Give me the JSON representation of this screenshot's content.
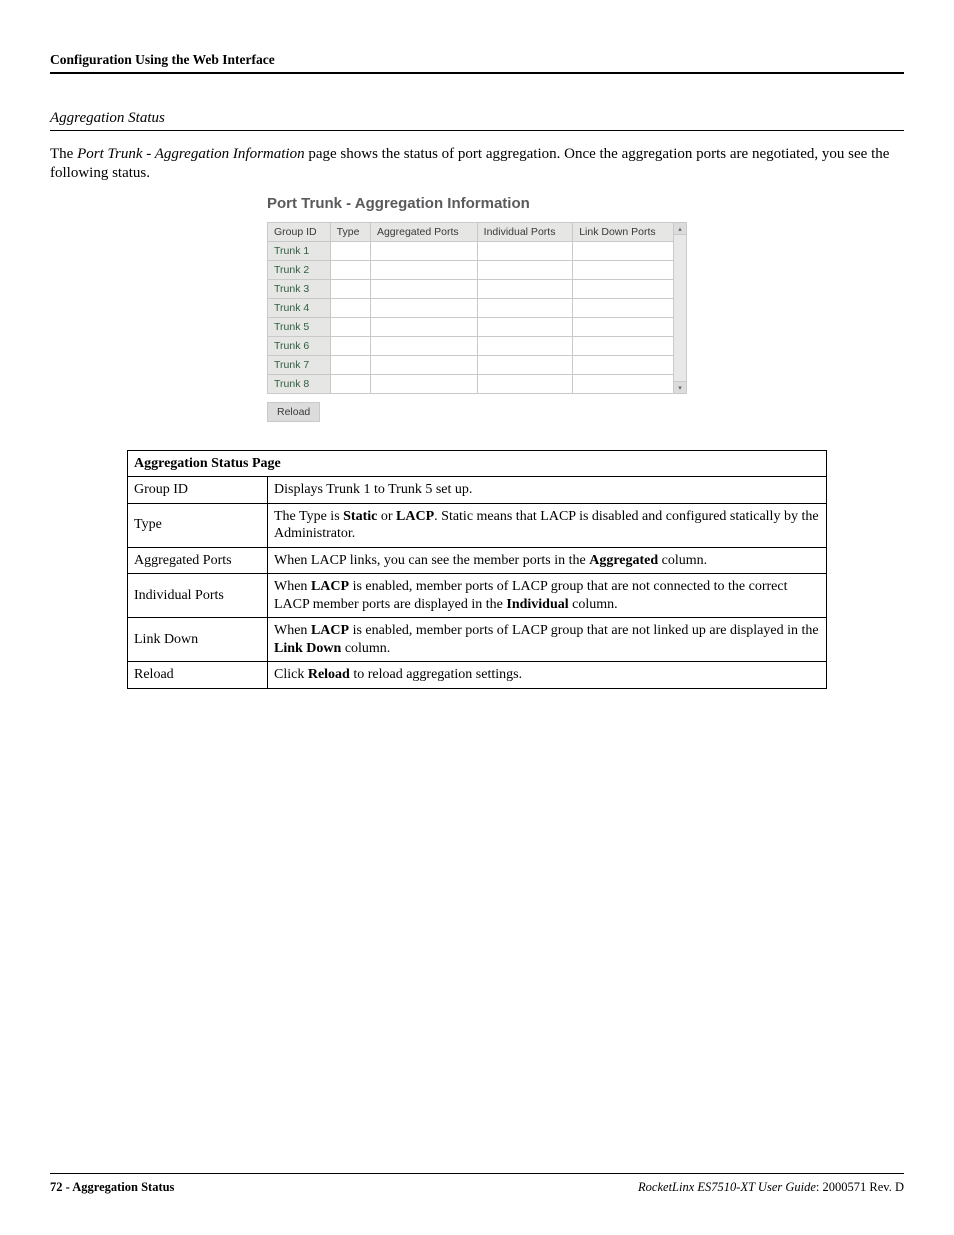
{
  "header": {
    "title": "Configuration Using the Web Interface"
  },
  "section": {
    "title": "Aggregation Status"
  },
  "intro": {
    "pre": "The ",
    "em": "Port Trunk - Aggregation Information",
    "post": " page shows the status of port aggregation. Once the aggregation ports are negotiated, you see the following status."
  },
  "figure": {
    "title": "Port Trunk - Aggregation Information",
    "headers": [
      "Group ID",
      "Type",
      "Aggregated Ports",
      "Individual Ports",
      "Link Down Ports"
    ],
    "rows": [
      {
        "group": "Trunk 1",
        "type": "",
        "agg": "",
        "ind": "",
        "down": ""
      },
      {
        "group": "Trunk 2",
        "type": "",
        "agg": "",
        "ind": "",
        "down": ""
      },
      {
        "group": "Trunk 3",
        "type": "",
        "agg": "",
        "ind": "",
        "down": ""
      },
      {
        "group": "Trunk 4",
        "type": "",
        "agg": "",
        "ind": "",
        "down": ""
      },
      {
        "group": "Trunk 5",
        "type": "",
        "agg": "",
        "ind": "",
        "down": ""
      },
      {
        "group": "Trunk 6",
        "type": "",
        "agg": "",
        "ind": "",
        "down": ""
      },
      {
        "group": "Trunk 7",
        "type": "",
        "agg": "",
        "ind": "",
        "down": ""
      },
      {
        "group": "Trunk 8",
        "type": "",
        "agg": "",
        "ind": "",
        "down": ""
      }
    ],
    "button": "Reload"
  },
  "desc": {
    "caption": "Aggregation Status Page",
    "rows": [
      {
        "label": "Group ID",
        "text": "Displays Trunk 1 to Trunk 5 set up."
      },
      {
        "label": "Type",
        "text": "The Type is <b>Static</b> or <b>LACP</b>. Static means that LACP is disabled and configured statically by the Administrator."
      },
      {
        "label": "Aggregated Ports",
        "text": "When LACP links, you can see the member ports in the <b>Aggregated</b> column."
      },
      {
        "label": "Individual Ports",
        "text": "When <b>LACP</b> is enabled, member ports of LACP group that are not connected to the correct LACP member ports are displayed in the <b>Individual</b> column."
      },
      {
        "label": "Link Down",
        "text": "When <b>LACP</b> is enabled, member ports of LACP group that are not linked up are displayed in the <b>Link Down</b> column."
      },
      {
        "label": "Reload",
        "text": "Click <b>Reload</b> to reload aggregation settings."
      }
    ]
  },
  "footer": {
    "page": "72",
    "pageLabel": " - Aggregation Status",
    "product": "RocketLinx ES7510-XT  User Guide",
    "rev": ": 2000571 Rev. D"
  },
  "scroll": {
    "up": "▴",
    "down": "▾"
  }
}
